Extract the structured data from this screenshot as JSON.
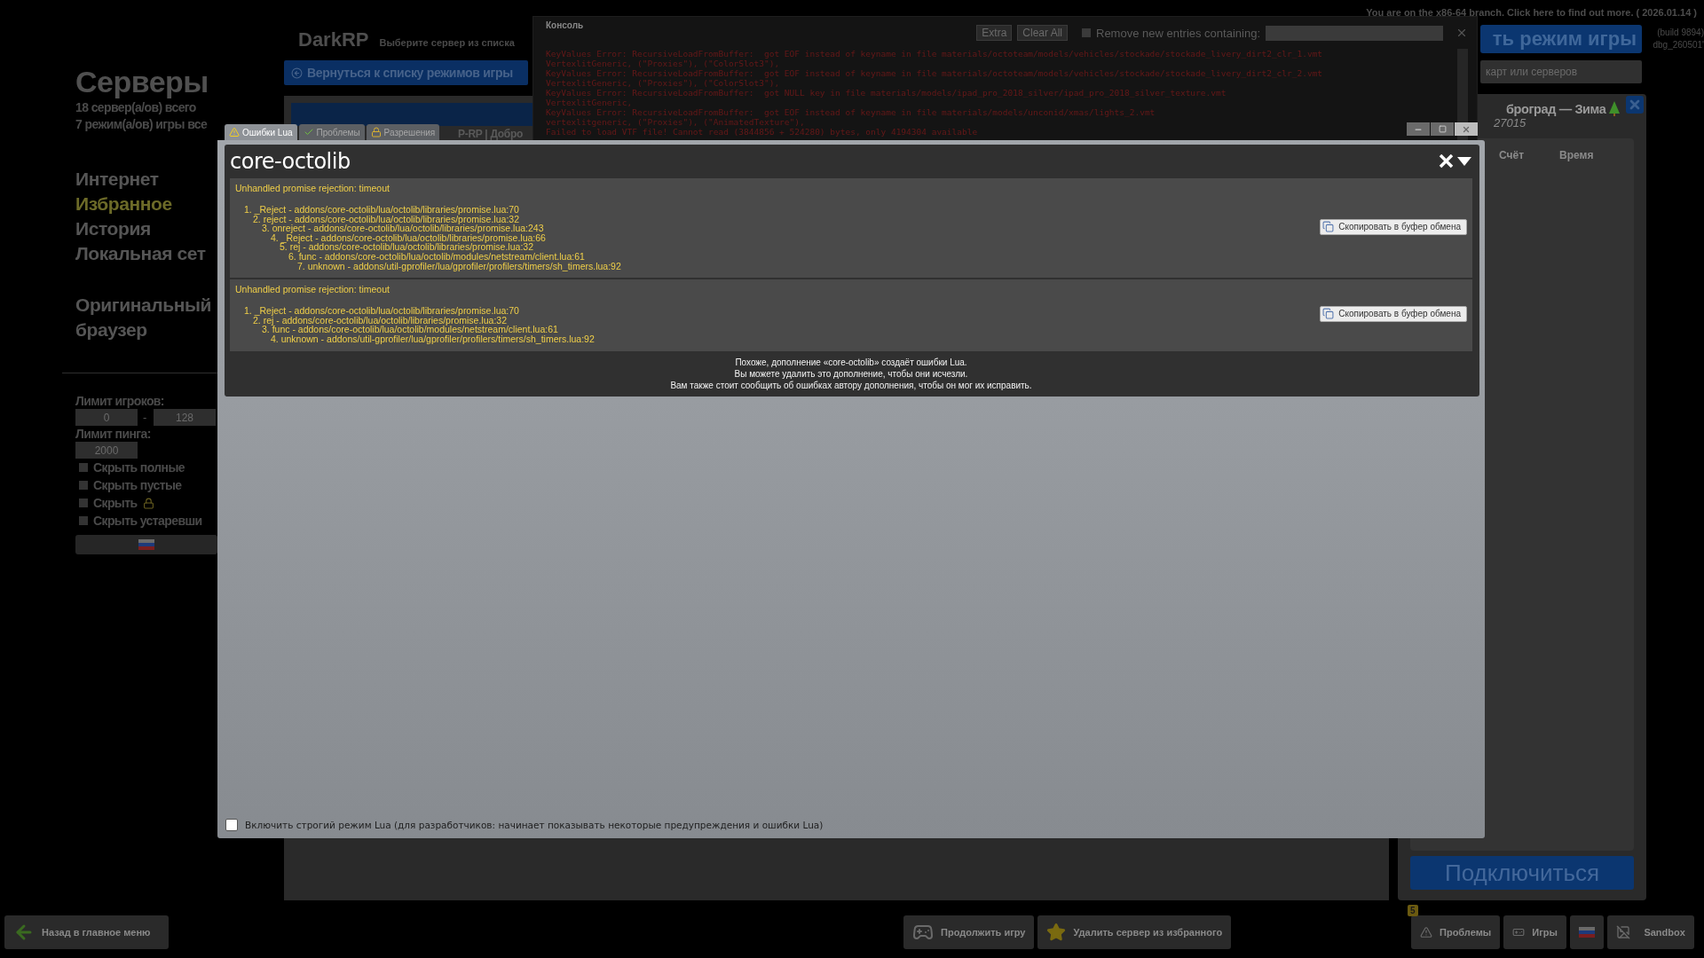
{
  "notice": "You are on the x86-64 branch. Click here to find out more. ( 2026.01.14 )",
  "build_info": [
    "(build 9894)",
    "dbg_260501'"
  ],
  "sidebar": {
    "title": "Серверы",
    "stats": [
      "18 сервер(а/ов) всего",
      "7 режим(а/ов) игры все"
    ],
    "nav": [
      {
        "label": "Интернет",
        "selected": false
      },
      {
        "label": "Избранное",
        "selected": true
      },
      {
        "label": "История",
        "selected": false
      },
      {
        "label": "Локальная сет",
        "selected": false
      }
    ],
    "extra_nav": [
      {
        "label": "Оригинальный браузер",
        "selected": false
      }
    ],
    "filters": {
      "player_limit": {
        "label": "Лимит игроков:",
        "min": "0",
        "separator": "-",
        "max": "128"
      },
      "ping_limit": {
        "label": "Лимит пинга:",
        "value": "2000"
      },
      "checkboxes": [
        {
          "label": "Скрыть полные",
          "checked": false,
          "kind": "text"
        },
        {
          "label": "Скрыть пустые",
          "checked": false,
          "kind": "text"
        },
        {
          "label": "Скрыть",
          "checked": false,
          "kind": "lock"
        },
        {
          "label": "Скрыть устаревши",
          "checked": false,
          "kind": "text"
        }
      ]
    }
  },
  "main": {
    "title": "DarkRP",
    "subtitle": "Выберите сервер из списка",
    "back_button": "Вернуться к списку режимов игры",
    "server_row": "P-RP | Добро"
  },
  "right": {
    "mode_button": "ть режим игры",
    "search_placeholder": "карт или серверов",
    "server": {
      "name": "броград — Зима",
      "port": "27015"
    },
    "columns": [
      "Счёт",
      "Время"
    ],
    "connect_button": "Подключиться"
  },
  "console": {
    "title": "Консоль",
    "buttons": [
      "Extra",
      "Clear All"
    ],
    "filter": {
      "label": "Remove new entries containing:",
      "checked": false
    },
    "lines": [
      "KeyValues Error: RecursiveLoadFromBuffer:  got EOF instead of keyname in file materials/octoteam/models/vehicles/stockade/stockade_livery_dirt2_clr_1.vmt",
      "VertexlitGeneric, (\"Proxies\"), (\"ColorSlot3\"),",
      "KeyValues Error: RecursiveLoadFromBuffer:  got EOF instead of keyname in file materials/octoteam/models/vehicles/stockade/stockade_livery_dirt2_clr_2.vmt",
      "VertexlitGeneric, (\"Proxies\"), (\"ColorSlot3\"),",
      "KeyValues Error: RecursiveLoadFromBuffer:  got NULL key in file materials/models/ipad_pro_2018_silver/ipad_pro_2018_silver_texture.vmt",
      "VertexlitGeneric,",
      "KeyValues Error: RecursiveLoadFromBuffer:  got EOF instead of keyname in file materials/models/unconid/xmas/lights_2.vmt",
      "vertexlitgeneric, (\"Proxies\"), (\"AnimatedTexture\"),",
      "Failed to load VTF file! Cannot read (3844856 + 524280) bytes, only 4194304 available"
    ]
  },
  "lua_errors": {
    "tabs": [
      {
        "label": "Ошибки Lua",
        "selected": true
      },
      {
        "label": "Проблемы",
        "selected": false
      },
      {
        "label": "Разрешения",
        "selected": false
      }
    ],
    "addon": "core-octolib",
    "errors": [
      {
        "message": "Unhandled promise rejection: timeout",
        "copy_button": "Скопировать в буфер обмена",
        "trace": [
          "1. _Reject - addons/core-octolib/lua/octolib/libraries/promise.lua:70",
          "2. reject - addons/core-octolib/lua/octolib/libraries/promise.lua:32",
          "3. onreject - addons/core-octolib/lua/octolib/libraries/promise.lua:243",
          "4. _Reject - addons/core-octolib/lua/octolib/libraries/promise.lua:66",
          "5. rej - addons/core-octolib/lua/octolib/libraries/promise.lua:32",
          "6. func - addons/core-octolib/lua/octolib/modules/netstream/client.lua:61",
          "7. unknown - addons/util-gprofiler/lua/gprofiler/profilers/timers/sh_timers.lua:92"
        ]
      },
      {
        "message": "Unhandled promise rejection: timeout",
        "copy_button": "Скопировать в буфер обмена",
        "trace": [
          "1. _Reject - addons/core-octolib/lua/octolib/libraries/promise.lua:70",
          "2. rej - addons/core-octolib/lua/octolib/libraries/promise.lua:32",
          "3. func - addons/core-octolib/lua/octolib/modules/netstream/client.lua:61",
          "4. unknown - addons/util-gprofiler/lua/gprofiler/profilers/timers/sh_timers.lua:92"
        ]
      }
    ],
    "footer": [
      "Похоже, дополнение «core-octolib» создаёт ошибки Lua.",
      "Вы можете удалить это дополнение, чтобы они исчезли.",
      "Вам также стоит сообщить об ошибках автору дополнения, чтобы он мог их исправить."
    ],
    "strict_mode": {
      "label": "Включить строгий режим Lua (для разработчиков: начинает показывать некоторые предупреждения и ошибки Lua)",
      "checked": false
    }
  },
  "bottom_bar": {
    "back_button": "Назад в главное меню",
    "center": [
      {
        "label": "Продолжить игру"
      },
      {
        "label": "Удалить сервер из избранного"
      }
    ],
    "problems": {
      "label": "Проблемы",
      "count": "5"
    },
    "games": "Игры",
    "gamemode": "Sandbox"
  }
}
